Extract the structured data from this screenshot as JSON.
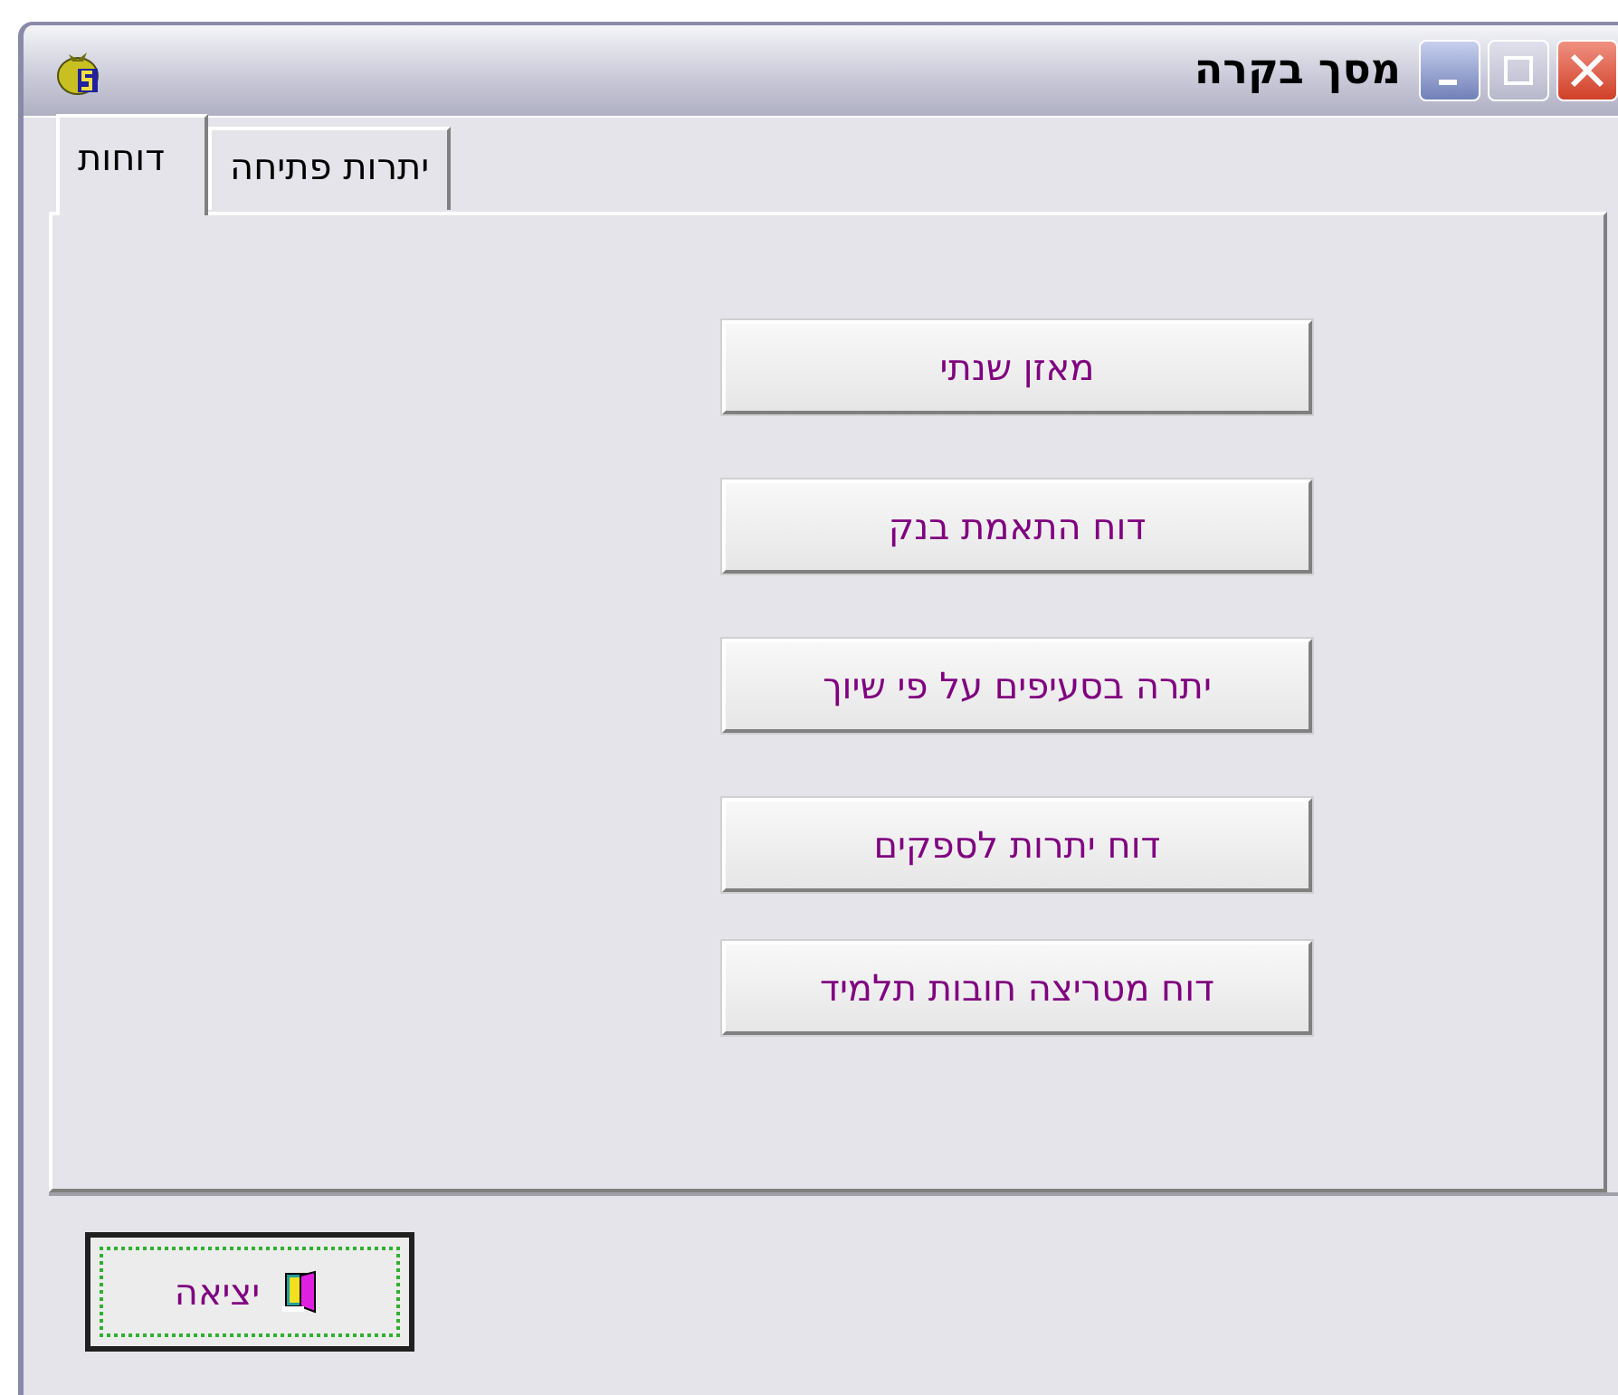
{
  "window": {
    "title": "מסך בקרה"
  },
  "tabs": [
    {
      "label": "דוחות",
      "selected": true
    },
    {
      "label": "יתרות פתיחה",
      "selected": false
    }
  ],
  "report_buttons": [
    "מאזן שנתי",
    "דוח התאמת בנק",
    "יתרה בסעיפים על פי שיוך",
    "דוח יתרות לספקים",
    "דוח מטריצה חובות תלמיד"
  ],
  "exit_button": {
    "label": "יציאה",
    "focused": true
  }
}
